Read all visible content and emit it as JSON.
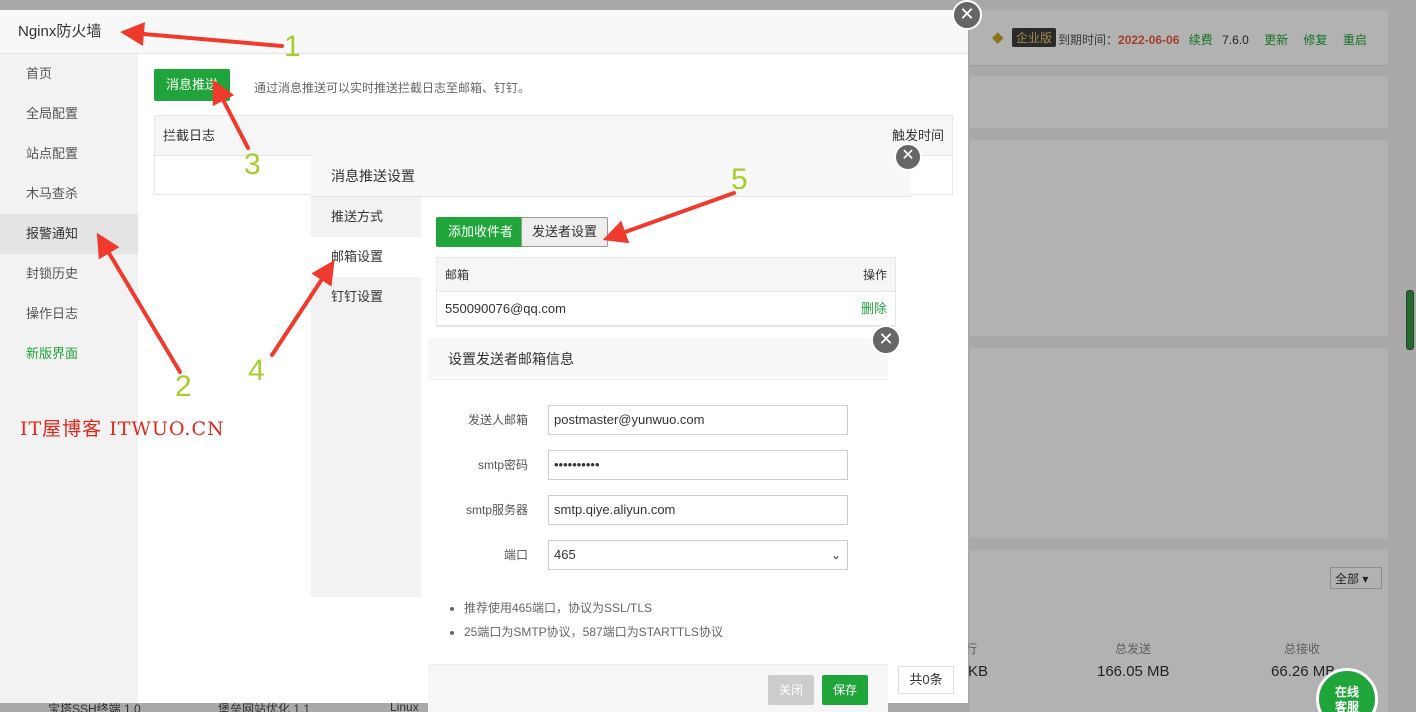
{
  "background": {
    "vip_label": "企业版",
    "expire_label": "到期时间：",
    "expire_date": "2022-06-06",
    "renew": "续费",
    "version": "7.6.0",
    "links": [
      "更新",
      "修复",
      "重启"
    ],
    "filter_select": "全部",
    "stats": [
      {
        "label": "行",
        "value": "KB"
      },
      {
        "label": "总发送",
        "value": "166.05 MB"
      },
      {
        "label": "总接收",
        "value": "66.26 MB"
      }
    ],
    "bottom_items": [
      "宝塔SSH终端 1.0",
      "堡垒网站优化 1.1",
      "Linux"
    ]
  },
  "firewall": {
    "title": "Nginx防火墙",
    "menu": [
      {
        "label": "首页"
      },
      {
        "label": "全局配置"
      },
      {
        "label": "站点配置"
      },
      {
        "label": "木马查杀"
      },
      {
        "label": "报警通知"
      },
      {
        "label": "封锁历史"
      },
      {
        "label": "操作日志"
      },
      {
        "label": "新版界面"
      }
    ],
    "push_button": "消息推送",
    "push_desc": "通过消息推送可以实时推送拦截日志至邮箱、钉钉。",
    "table_headers": [
      "拦截日志",
      "触发时间"
    ],
    "pager": "共0条"
  },
  "watermark": "IT屋博客 ITWUO.CN",
  "msg_push": {
    "title": "消息推送设置",
    "tabs": [
      "推送方式",
      "邮箱设置",
      "钉钉设置"
    ],
    "add_button": "添加收件者",
    "sender_button": "发送者设置",
    "headers": [
      "邮箱",
      "操作"
    ],
    "rows": [
      {
        "email": "550090076@qq.com",
        "action": "删除"
      }
    ]
  },
  "sender_dialog": {
    "title": "设置发送者邮箱信息",
    "fields": {
      "email_label": "发送人邮箱",
      "email_value": "postmaster@yunwuo.com",
      "password_label": "smtp密码",
      "password_value": "••••••••••",
      "server_label": "smtp服务器",
      "server_value": "smtp.qiye.aliyun.com",
      "port_label": "端口",
      "port_value": "465"
    },
    "tips": [
      "推荐使用465端口，协议为SSL/TLS",
      "25端口为SMTP协议，587端口为STARTTLS协议"
    ],
    "close_button": "关闭",
    "save_button": "保存"
  },
  "annotations": [
    "1",
    "2",
    "3",
    "4",
    "5"
  ],
  "chat_widget": {
    "line1": "在线",
    "line2": "客服"
  },
  "colors": {
    "accent": "#20a53a",
    "arrow": "#f03a2e",
    "annotation_number": "#a5cd2e",
    "watermark": "#e0281e"
  }
}
